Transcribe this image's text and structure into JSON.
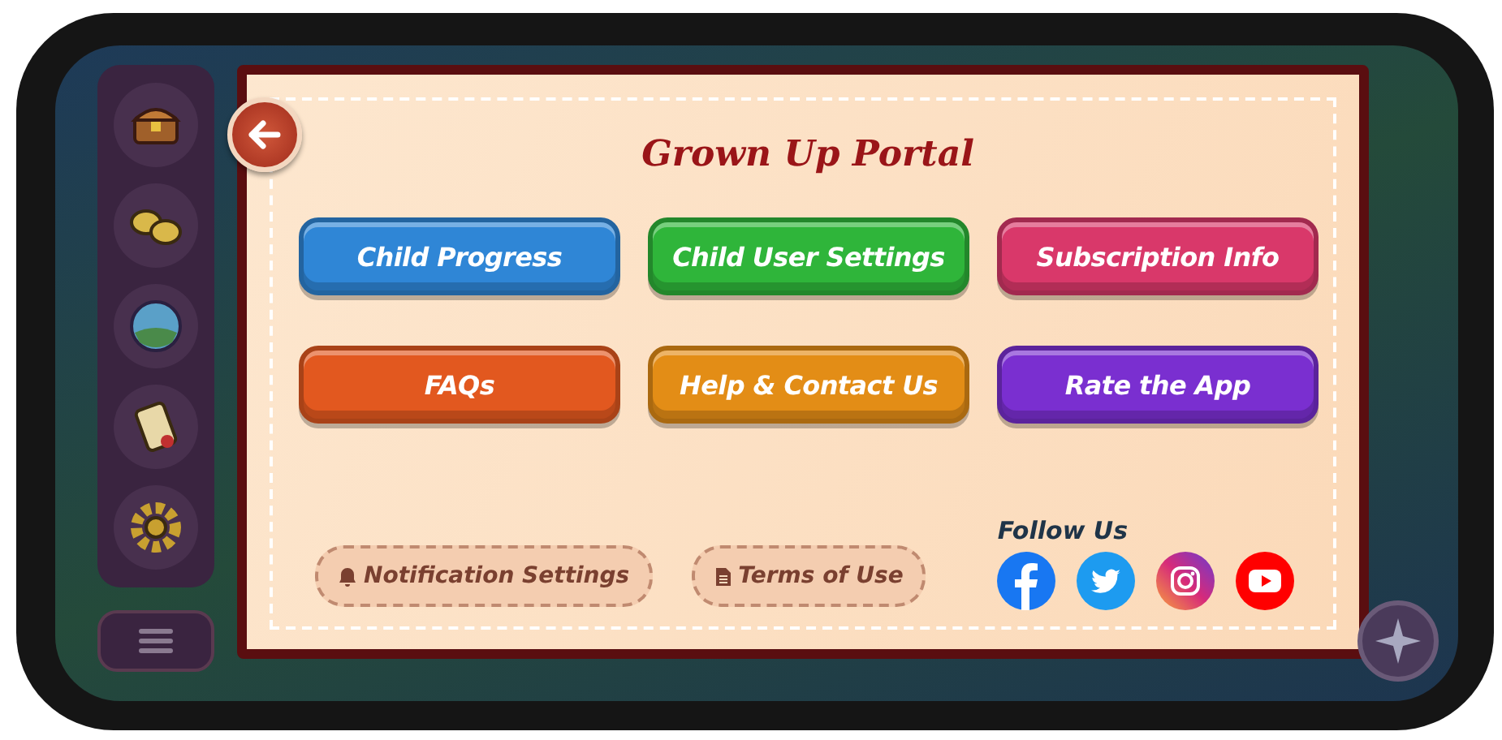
{
  "panel": {
    "title": "Grown Up Portal"
  },
  "buttons": [
    {
      "label": "Child Progress",
      "color": "#2f86d6"
    },
    {
      "label": "Child User Settings",
      "color": "#2fb53a"
    },
    {
      "label": "Subscription Info",
      "color": "#d9386a"
    },
    {
      "label": "FAQs",
      "color": "#e2581f"
    },
    {
      "label": "Help & Contact Us",
      "color": "#e38d16"
    },
    {
      "label": "Rate the App",
      "color": "#7a2fd0"
    }
  ],
  "footer_links": [
    {
      "label": "Notification Settings",
      "kind": "bell"
    },
    {
      "label": "Terms of Use",
      "kind": "document"
    }
  ],
  "social": {
    "heading": "Follow Us"
  }
}
